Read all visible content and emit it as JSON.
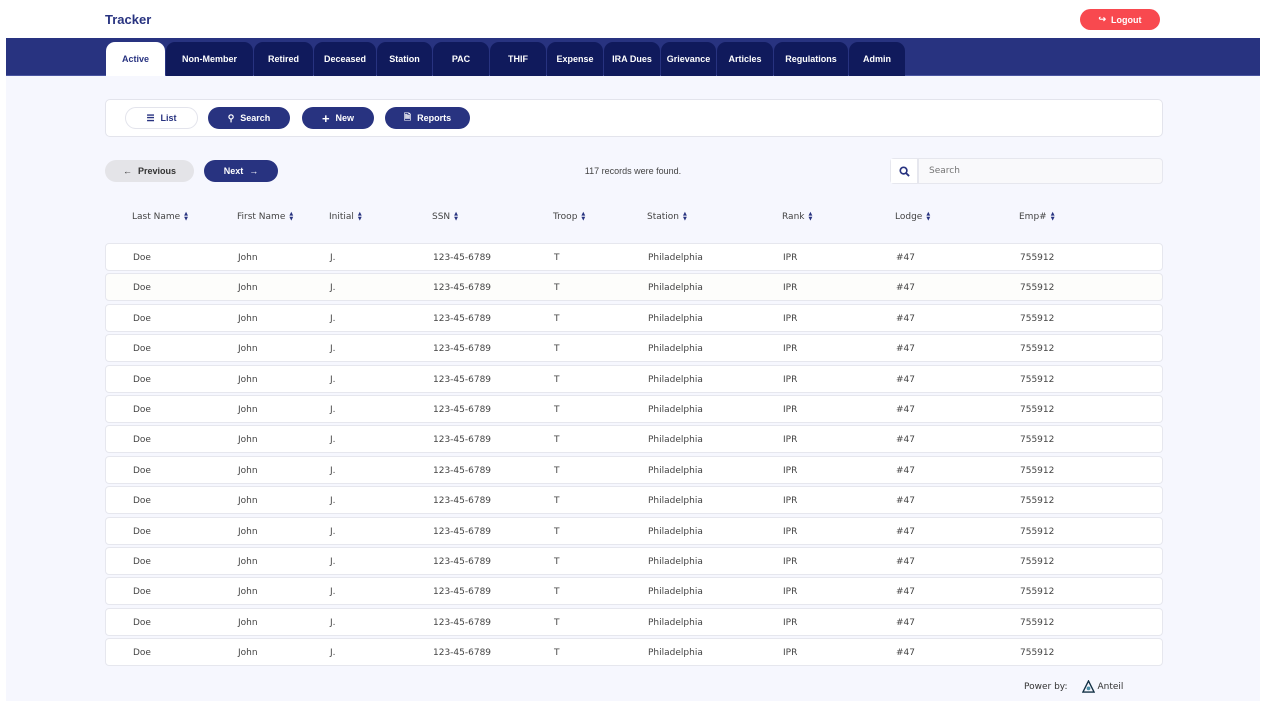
{
  "app": {
    "title": "Tracker",
    "logout_label": "Logout"
  },
  "tabs": [
    "Active",
    "Non-Member",
    "Retired",
    "Deceased",
    "Station",
    "PAC",
    "THIF",
    "Expense",
    "IRA Dues",
    "Grievance",
    "Articles",
    "Regulations",
    "Admin"
  ],
  "active_tab": "Active",
  "toolbar": {
    "list": "List",
    "search": "Search",
    "new": "New",
    "reports": "Reports"
  },
  "pager": {
    "previous": "Previous",
    "next": "Next",
    "count_text": "117 records were found."
  },
  "search": {
    "placeholder": "Search",
    "value": ""
  },
  "columns": [
    "Last Name",
    "First Name",
    "Initial",
    "SSN",
    "Troop",
    "Station",
    "Rank",
    "Lodge",
    "Emp#"
  ],
  "rows": [
    [
      "Doe",
      "John",
      "J.",
      "123-45-6789",
      "T",
      "Philadelphia",
      "IPR",
      "#47",
      "755912"
    ],
    [
      "Doe",
      "John",
      "J.",
      "123-45-6789",
      "T",
      "Philadelphia",
      "IPR",
      "#47",
      "755912"
    ],
    [
      "Doe",
      "John",
      "J.",
      "123-45-6789",
      "T",
      "Philadelphia",
      "IPR",
      "#47",
      "755912"
    ],
    [
      "Doe",
      "John",
      "J.",
      "123-45-6789",
      "T",
      "Philadelphia",
      "IPR",
      "#47",
      "755912"
    ],
    [
      "Doe",
      "John",
      "J.",
      "123-45-6789",
      "T",
      "Philadelphia",
      "IPR",
      "#47",
      "755912"
    ],
    [
      "Doe",
      "John",
      "J.",
      "123-45-6789",
      "T",
      "Philadelphia",
      "IPR",
      "#47",
      "755912"
    ],
    [
      "Doe",
      "John",
      "J.",
      "123-45-6789",
      "T",
      "Philadelphia",
      "IPR",
      "#47",
      "755912"
    ],
    [
      "Doe",
      "John",
      "J.",
      "123-45-6789",
      "T",
      "Philadelphia",
      "IPR",
      "#47",
      "755912"
    ],
    [
      "Doe",
      "John",
      "J.",
      "123-45-6789",
      "T",
      "Philadelphia",
      "IPR",
      "#47",
      "755912"
    ],
    [
      "Doe",
      "John",
      "J.",
      "123-45-6789",
      "T",
      "Philadelphia",
      "IPR",
      "#47",
      "755912"
    ],
    [
      "Doe",
      "John",
      "J.",
      "123-45-6789",
      "T",
      "Philadelphia",
      "IPR",
      "#47",
      "755912"
    ],
    [
      "Doe",
      "John",
      "J.",
      "123-45-6789",
      "T",
      "Philadelphia",
      "IPR",
      "#47",
      "755912"
    ],
    [
      "Doe",
      "John",
      "J.",
      "123-45-6789",
      "T",
      "Philadelphia",
      "IPR",
      "#47",
      "755912"
    ],
    [
      "Doe",
      "John",
      "J.",
      "123-45-6789",
      "T",
      "Philadelphia",
      "IPR",
      "#47",
      "755912"
    ]
  ],
  "footer": {
    "powered_by": "Power by:",
    "brand": "Anteil"
  },
  "colors": {
    "primary": "#283380",
    "tab_dark": "#101a5c",
    "logout": "#f8494f",
    "background": "#f6f7fe"
  }
}
